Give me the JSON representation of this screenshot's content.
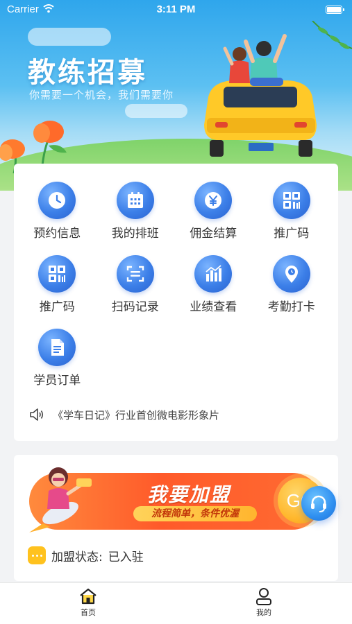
{
  "status_bar": {
    "carrier": "Carrier",
    "time": "3:11 PM"
  },
  "hero": {
    "title": "教练招募",
    "subtitle": "你需要一个机会，我们需要你"
  },
  "menu": {
    "items": [
      {
        "label": "预约信息",
        "icon": "clock-icon"
      },
      {
        "label": "我的排班",
        "icon": "calendar-icon"
      },
      {
        "label": "佣金结算",
        "icon": "yen-coin-icon"
      },
      {
        "label": "推广码",
        "icon": "qr-code-icon"
      },
      {
        "label": "推广码",
        "icon": "qr-code-icon"
      },
      {
        "label": "扫码记录",
        "icon": "scan-icon"
      },
      {
        "label": "业绩查看",
        "icon": "bar-chart-icon"
      },
      {
        "label": "考勤打卡",
        "icon": "location-clock-icon"
      },
      {
        "label": "学员订单",
        "icon": "document-icon"
      }
    ]
  },
  "notice": {
    "text": "《学车日记》行业首创微电影形象片"
  },
  "join": {
    "title": "我要加盟",
    "tag": "流程简单，条件优渥",
    "go_label": "GO",
    "status_label": "加盟状态:",
    "status_value": "已入驻"
  },
  "tabbar": {
    "home_label": "首页",
    "mine_label": "我的"
  },
  "colors": {
    "accent_blue": "#3c7fe8",
    "banner_orange": "#ff5a2a",
    "status_yellow": "#ffc21e"
  }
}
